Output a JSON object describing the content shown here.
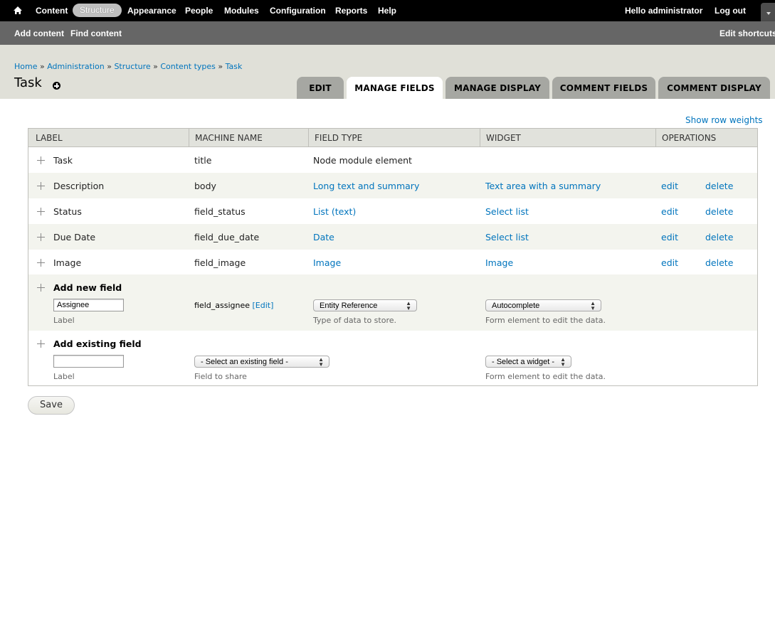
{
  "toolbar": {
    "menu": [
      "Content",
      "Structure",
      "Appearance",
      "People",
      "Modules",
      "Configuration",
      "Reports",
      "Help"
    ],
    "active": "Structure",
    "hello": "Hello",
    "user": "administrator",
    "logout": "Log out"
  },
  "shortcuts": {
    "add_content": "Add content",
    "find_content": "Find content",
    "edit_shortcuts": "Edit shortcuts"
  },
  "breadcrumb": [
    "Home",
    "Administration",
    "Structure",
    "Content types",
    "Task"
  ],
  "breadcrumb_sep": "»",
  "page_title": "Task",
  "tabs": [
    "EDIT",
    "MANAGE FIELDS",
    "MANAGE DISPLAY",
    "COMMENT FIELDS",
    "COMMENT DISPLAY"
  ],
  "active_tab": "MANAGE FIELDS",
  "show_row_weights": "Show row weights",
  "table": {
    "headers": [
      "LABEL",
      "MACHINE NAME",
      "FIELD TYPE",
      "WIDGET",
      "OPERATIONS"
    ],
    "rows": [
      {
        "label": "Task",
        "machine": "title",
        "type": "Node module element",
        "widget": "",
        "edit": "",
        "delete": ""
      },
      {
        "label": "Description",
        "machine": "body",
        "type": "Long text and summary",
        "widget": "Text area with a summary",
        "edit": "edit",
        "delete": "delete"
      },
      {
        "label": "Status",
        "machine": "field_status",
        "type": "List (text)",
        "widget": "Select list",
        "edit": "edit",
        "delete": "delete"
      },
      {
        "label": "Due Date",
        "machine": "field_due_date",
        "type": "Date",
        "widget": "Select list",
        "edit": "edit",
        "delete": "delete"
      },
      {
        "label": "Image",
        "machine": "field_image",
        "type": "Image",
        "widget": "Image",
        "edit": "edit",
        "delete": "delete"
      }
    ]
  },
  "add_new": {
    "heading": "Add new field",
    "label_value": "Assignee",
    "label_desc": "Label",
    "machine": "field_assignee",
    "machine_edit": "[Edit]",
    "type_value": "Entity Reference",
    "type_desc": "Type of data to store.",
    "widget_value": "Autocomplete",
    "widget_desc": "Form element to edit the data."
  },
  "add_existing": {
    "heading": "Add existing field",
    "label_value": "",
    "label_desc": "Label",
    "field_value": "- Select an existing field -",
    "field_desc": "Field to share",
    "widget_value": "- Select a widget -",
    "widget_desc": "Form element to edit the data."
  },
  "save": "Save",
  "colors": {
    "link": "#0074bd",
    "toolbar": "#000000",
    "shortcuts": "#666666",
    "header": "#e0e0d8"
  }
}
